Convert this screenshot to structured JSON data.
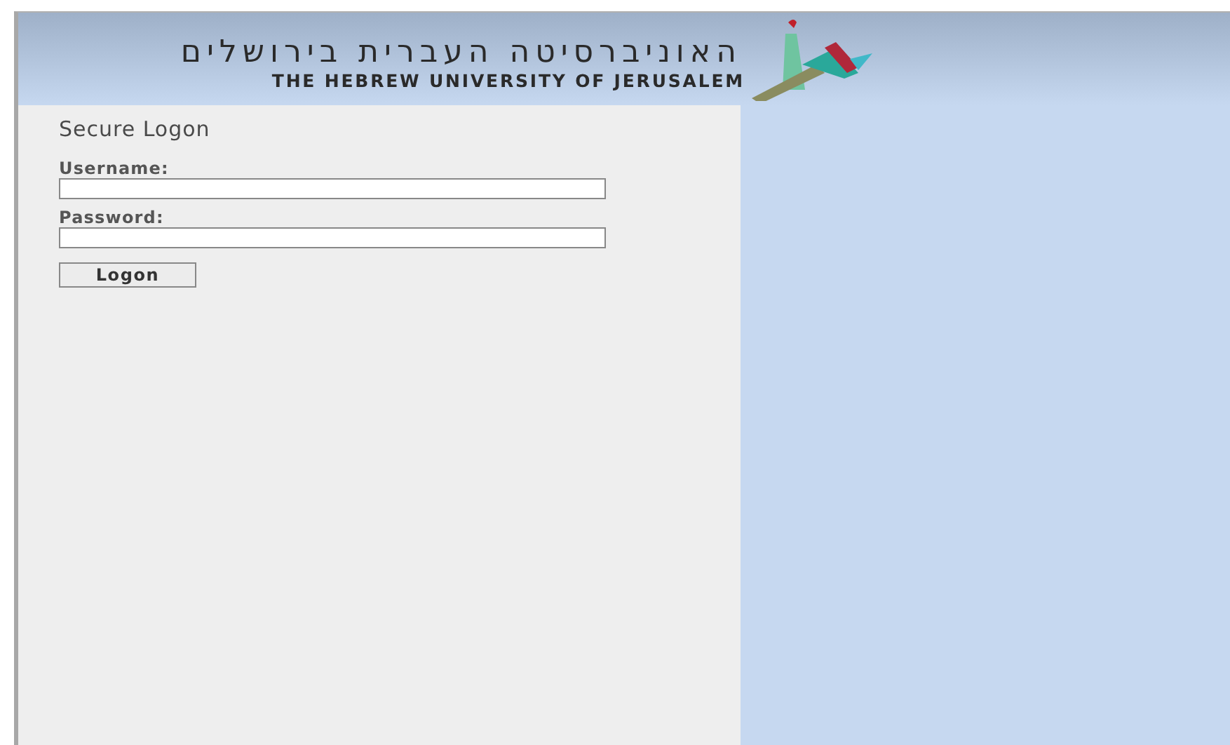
{
  "header": {
    "name_hebrew": "האוניברסיטה העברית בירושלים",
    "name_english": "THE HEBREW UNIVERSITY OF JERUSALEM"
  },
  "login": {
    "title": "Secure Logon",
    "fields": [
      {
        "label": "Username:"
      },
      {
        "label": "Password:"
      }
    ],
    "button": "Logon"
  }
}
